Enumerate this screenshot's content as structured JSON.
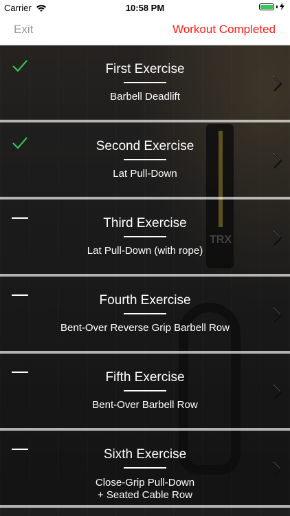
{
  "status_bar": {
    "carrier": "Carrier",
    "time": "10:58 PM",
    "battery_level": 1.0
  },
  "nav": {
    "exit_label": "Exit",
    "complete_label": "Workout Completed",
    "complete_color": "#ff1a10"
  },
  "background": {
    "strap_text": "TRX"
  },
  "exercises": [
    {
      "title": "First Exercise",
      "description": "Barbell Deadlift",
      "status": "completed",
      "icon": "checkmark-icon"
    },
    {
      "title": "Second Exercise",
      "description": "Lat Pull-Down",
      "status": "completed",
      "icon": "checkmark-icon"
    },
    {
      "title": "Third Exercise",
      "description": "Lat Pull-Down (with rope)",
      "status": "pending",
      "icon": "dash-icon"
    },
    {
      "title": "Fourth Exercise",
      "description": "Bent-Over Reverse Grip Barbell Row",
      "status": "pending",
      "icon": "dash-icon"
    },
    {
      "title": "Fifth Exercise",
      "description": "Bent-Over Barbell Row",
      "status": "pending",
      "icon": "dash-icon"
    },
    {
      "title": "Sixth Exercise",
      "description_lines": [
        "Close-Grip Pull-Down",
        "+ Seated Cable Row"
      ],
      "status": "pending",
      "icon": "dash-icon"
    }
  ],
  "colors": {
    "check_green": "#2bd45a",
    "pending_white": "#ffffff"
  }
}
